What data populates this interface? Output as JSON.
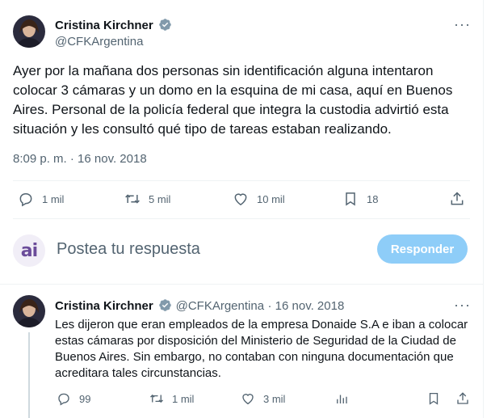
{
  "main_tweet": {
    "author_name": "Cristina Kirchner",
    "author_handle": "@CFKArgentina",
    "more_label": "···",
    "text": "Ayer por la mañana dos personas sin identificación alguna intentaron colocar 3 cámaras y un domo en la esquina de mi casa, aquí en Buenos Aires. Personal de la policía federal que integra la custodia advirtió esta situación y les consultó qué tipo de tareas estaban realizando.",
    "timestamp": "8:09 p. m. · 16 nov. 2018",
    "actions": {
      "replies": "1 mil",
      "retweets": "5 mil",
      "likes": "10 mil",
      "bookmarks": "18"
    }
  },
  "reply_composer": {
    "avatar_text": "ai",
    "placeholder": "Postea tu respuesta",
    "button_label": "Responder"
  },
  "reply_tweet": {
    "author_name": "Cristina Kirchner",
    "author_handle": "@CFKArgentina",
    "date": "· 16 nov. 2018",
    "more_label": "···",
    "text": "Les dijeron que eran empleados de la empresa Donaide S.A e iban a colocar estas cámaras por disposición del Ministerio de Seguridad de la Ciudad de Buenos Aires. Sin embargo, no contaban con ninguna documentación que acreditara tales circunstancias.",
    "actions": {
      "replies": "99",
      "retweets": "1 mil",
      "likes": "3 mil"
    }
  },
  "colors": {
    "verified_badge": "#829aab",
    "reply_button": "#8ecdf8",
    "secondary_text": "#536471",
    "composer_avatar": "#6b4c9a"
  }
}
